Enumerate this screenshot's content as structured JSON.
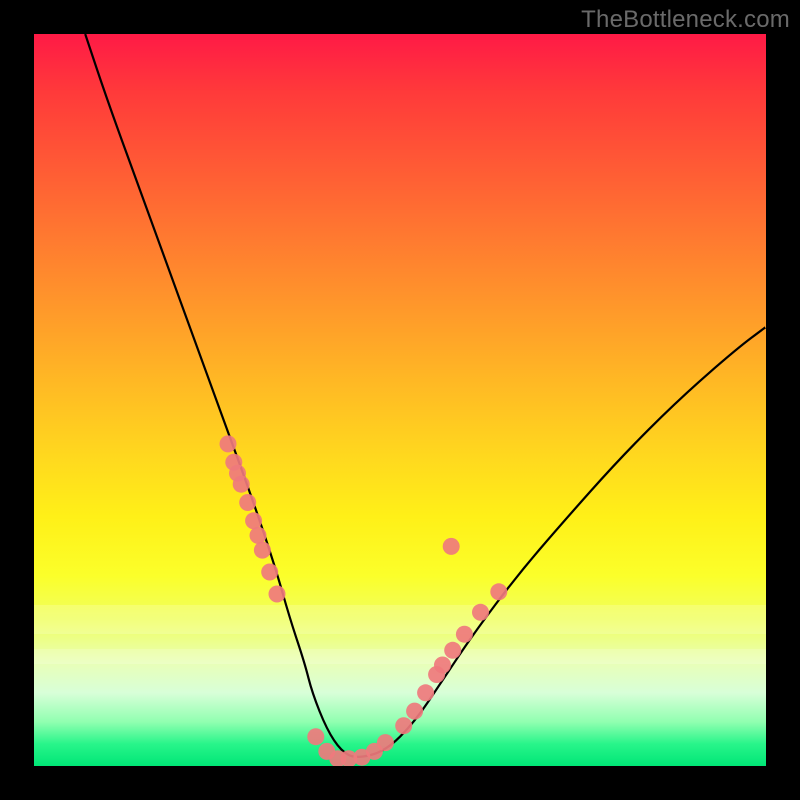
{
  "watermark": "TheBottleneck.com",
  "colors": {
    "background": "#000000",
    "dot": "#ef7a7d",
    "curve": "#000000"
  },
  "chart_data": {
    "type": "line",
    "title": "",
    "xlabel": "",
    "ylabel": "",
    "xlim": [
      0,
      100
    ],
    "ylim": [
      0,
      100
    ],
    "grid": false,
    "legend": false,
    "series": [
      {
        "name": "bottleneck-curve",
        "x": [
          7,
          10,
          14,
          18,
          22,
          26,
          30,
          33,
          35,
          37,
          38,
          40,
          42,
          44,
          48,
          52,
          56,
          60,
          66,
          72,
          80,
          88,
          96,
          100
        ],
        "y": [
          100,
          91,
          80,
          69,
          58,
          47,
          36,
          27,
          20,
          14,
          10,
          5,
          2,
          1,
          2,
          6,
          12,
          18,
          26,
          33,
          42,
          50,
          57,
          60
        ]
      }
    ],
    "points": [
      {
        "name": "left-cluster",
        "x": [
          26.5,
          27.3,
          27.8,
          28.3,
          29.2,
          30.0,
          30.6,
          31.2,
          32.2,
          33.2
        ],
        "y": [
          44,
          41.5,
          40,
          38.5,
          36,
          33.5,
          31.5,
          29.5,
          26.5,
          23.5
        ]
      },
      {
        "name": "valley-cluster",
        "x": [
          38.5,
          40.0,
          41.5,
          43.0,
          44.8,
          46.5,
          48.0
        ],
        "y": [
          4.0,
          2.0,
          1.0,
          1.0,
          1.2,
          2.0,
          3.2
        ]
      },
      {
        "name": "right-cluster",
        "x": [
          50.5,
          52.0,
          53.5,
          55.0,
          55.8,
          57.2,
          58.8,
          61.0,
          63.5
        ],
        "y": [
          5.5,
          7.5,
          10.0,
          12.5,
          13.8,
          15.8,
          18.0,
          21.0,
          23.8
        ]
      },
      {
        "name": "right-outlier",
        "x": [
          57.0
        ],
        "y": [
          30.0
        ]
      }
    ],
    "bands": [
      {
        "name": "pale-band-1",
        "y0": 78,
        "y1": 82
      },
      {
        "name": "pale-band-2",
        "y0": 84,
        "y1": 86
      }
    ]
  }
}
